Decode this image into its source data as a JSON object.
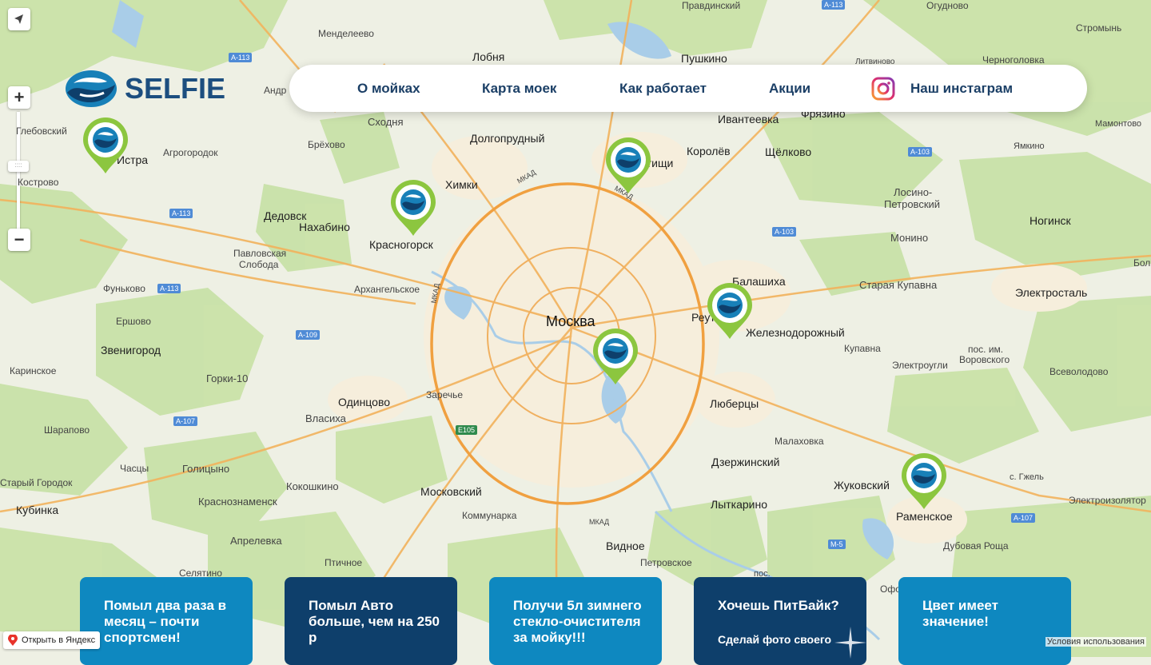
{
  "brand": {
    "name": "SELFIE",
    "logo_color": "#1c4e7f"
  },
  "nav": {
    "items": [
      "О мойках",
      "Карта моек",
      "Как работает",
      "Акции"
    ],
    "instagram_label": "Наш инстаграм"
  },
  "map": {
    "center_label": "Москва",
    "city_labels": {
      "l1": "Лобня",
      "l2": "Пушкино",
      "l3": "Долгопрудный",
      "l4": "Химки",
      "l5": "Мытищи",
      "l6": "Королёв",
      "l7": "Щёлково",
      "l8": "Красногорск",
      "l9": "Балашиха",
      "l10": "Реутов",
      "l11": "Железнодорожный",
      "l12": "Люберцы",
      "l13": "Одинцово",
      "l14": "Дзержинский",
      "l15": "Лыткарино",
      "l16": "Жуковский",
      "l17": "Раменское",
      "l18": "Московский",
      "l19": "Видное",
      "l20": "Ногинск",
      "l21": "Электросталь",
      "l22": "Звенигород",
      "l23": "Истра",
      "l24": "Дедовск",
      "l25": "Нахабино",
      "l26": "Кубинка",
      "l27": "Фрязино",
      "l28": "Ивантеевка",
      "l29": "Голицыно",
      "l30": "Апрелевка",
      "l31": "Краснознаменск",
      "l32": "Власиха",
      "l33": "Монино",
      "l34": "Горки-10",
      "l35": "Кокошкино",
      "l36": "Старая Купавна",
      "l37": "Лосино-",
      "l38": "Петровский"
    },
    "small_labels": {
      "m1": "Менделеево",
      "m2": "Сходня",
      "m3": "Брёхово",
      "m4": "Агрогородок",
      "m5": "Глебовский",
      "m6": "Кострово",
      "m7": "Павловская",
      "m8": "Слобода",
      "m9": "Архангельское",
      "m10": "Фуньково",
      "m11": "Ершово",
      "m12": "Каринское",
      "m13": "Шарапово",
      "m14": "Часцы",
      "m15": "Старый Городок",
      "m16": "Селятино",
      "m17": "Птичное",
      "m18": "Коммунарка",
      "m19": "Петровское",
      "m20": "Малаховка",
      "m21": "Купавна",
      "m22": "Электроугли",
      "m23": "пос. им.",
      "m24": "Воровского",
      "m25": "Всеволодово",
      "m26": "с. Гжель",
      "m27": "Электроизолятор",
      "m28": "Дубовая Роща",
      "m29": "Мамонтово",
      "m30": "Ямкино",
      "m31": "Стромынь",
      "m32": "Огудново",
      "m33": "Правдинский",
      "m34": "Черноголовка",
      "m35": "Литвиново",
      "m36": "Заречье",
      "m37": "Андр",
      "m38": "Бол",
      "m39": "Офо",
      "m40": "пос.",
      "m41": "Сделай фото своего"
    },
    "road_labels": {
      "r1": "А-113",
      "r2": "А-113",
      "r3": "А-113",
      "r4": "А-103",
      "r5": "А-103",
      "r6": "А-109",
      "r7": "А-107",
      "r8": "А-107",
      "r9": "E105",
      "r10": "М-5",
      "r11": "А-113"
    },
    "mkad_label": "МКАД",
    "controls": {
      "zoom_in": "+",
      "zoom_out": "−",
      "zoom_handle": "::::"
    },
    "open_in_yandex": "Открыть в Яндекс",
    "terms": "Условия использования"
  },
  "cards": [
    {
      "title": "Помыл два раза в месяц – почти спортсмен!",
      "style": "light"
    },
    {
      "title": "Помыл Авто больше, чем на 250 р",
      "style": "dark"
    },
    {
      "title": "Получи 5л зимнего стекло-очистителя за мойку!!!",
      "style": "light"
    },
    {
      "title": "Хочешь ПитБайк?",
      "subtitle": "Сделай фото своего",
      "style": "dark"
    },
    {
      "title": "Цвет имеет значение!",
      "style": "light"
    }
  ],
  "colors": {
    "pin_green": "#8cc63f",
    "card_light": "#0e88c0",
    "card_dark": "#0e3f6b",
    "nav_text": "#1b3f66"
  }
}
